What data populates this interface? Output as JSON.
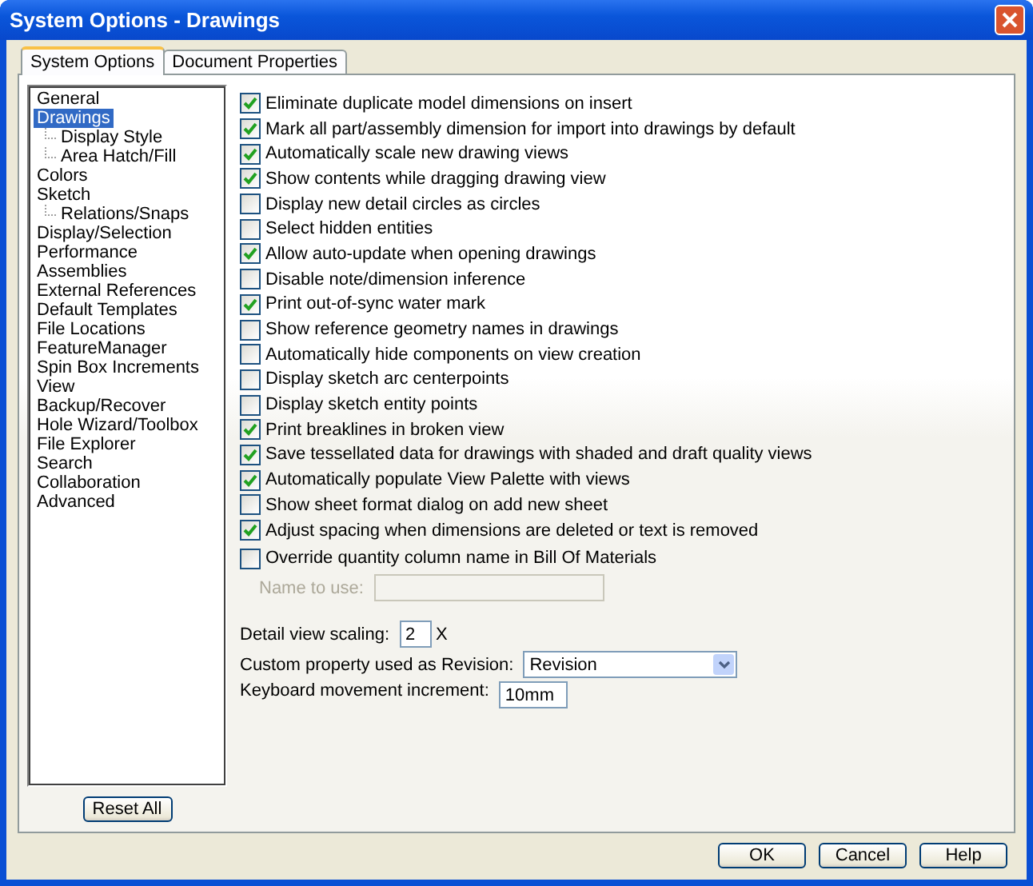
{
  "window": {
    "title": "System Options - Drawings"
  },
  "tabs": [
    {
      "label": "System Options",
      "selected": true
    },
    {
      "label": "Document Properties",
      "selected": false
    }
  ],
  "tree": [
    {
      "label": "General",
      "selected": false
    },
    {
      "label": "Drawings",
      "selected": true,
      "children": [
        {
          "label": "Display Style",
          "selected": false
        },
        {
          "label": "Area Hatch/Fill",
          "selected": false
        }
      ]
    },
    {
      "label": "Colors",
      "selected": false
    },
    {
      "label": "Sketch",
      "selected": false,
      "children": [
        {
          "label": "Relations/Snaps",
          "selected": false
        }
      ]
    },
    {
      "label": "Display/Selection",
      "selected": false
    },
    {
      "label": "Performance",
      "selected": false
    },
    {
      "label": "Assemblies",
      "selected": false
    },
    {
      "label": "External References",
      "selected": false
    },
    {
      "label": "Default Templates",
      "selected": false
    },
    {
      "label": "File Locations",
      "selected": false
    },
    {
      "label": "FeatureManager",
      "selected": false
    },
    {
      "label": "Spin Box Increments",
      "selected": false
    },
    {
      "label": "View",
      "selected": false
    },
    {
      "label": "Backup/Recover",
      "selected": false
    },
    {
      "label": "Hole Wizard/Toolbox",
      "selected": false
    },
    {
      "label": "File Explorer",
      "selected": false
    },
    {
      "label": "Search",
      "selected": false
    },
    {
      "label": "Collaboration",
      "selected": false
    },
    {
      "label": "Advanced",
      "selected": false
    }
  ],
  "reset_button": "Reset All",
  "options": [
    {
      "label": "Eliminate duplicate model dimensions on insert",
      "checked": true
    },
    {
      "label": "Mark all part/assembly dimension for import into drawings by default",
      "checked": true
    },
    {
      "label": "Automatically scale new drawing views",
      "checked": true
    },
    {
      "label": "Show contents while dragging drawing view",
      "checked": true
    },
    {
      "label": "Display new detail circles as circles",
      "checked": false
    },
    {
      "label": "Select hidden entities",
      "checked": false
    },
    {
      "label": "Allow auto-update when opening drawings",
      "checked": true
    },
    {
      "label": "Disable note/dimension inference",
      "checked": false
    },
    {
      "label": "Print out-of-sync water mark",
      "checked": true
    },
    {
      "label": "Show reference geometry names in drawings",
      "checked": false
    },
    {
      "label": "Automatically hide components on view creation",
      "checked": false
    },
    {
      "label": "Display sketch arc centerpoints",
      "checked": false
    },
    {
      "label": "Display sketch entity points",
      "checked": false
    },
    {
      "label": "Print breaklines in broken view",
      "checked": true
    },
    {
      "label": "Save tessellated data for drawings with shaded and draft quality views",
      "checked": true
    },
    {
      "label": "Automatically populate View Palette with views",
      "checked": true
    },
    {
      "label": "Show sheet format dialog on add new sheet",
      "checked": false
    },
    {
      "label": "Adjust spacing when dimensions are deleted or text is removed",
      "checked": true
    },
    {
      "label": "Override quantity column name in Bill Of Materials",
      "checked": false
    }
  ],
  "name_to_use": {
    "label": "Name to use:",
    "disabled": true
  },
  "detail_view_scaling": {
    "label": "Detail view scaling:",
    "value": "2",
    "unit": "X"
  },
  "revision_property": {
    "label": "Custom property used as Revision:",
    "value": "Revision"
  },
  "keyboard_increment": {
    "label": "Keyboard movement increment:",
    "value": "10mm"
  },
  "buttons": [
    "OK",
    "Cancel",
    "Help"
  ]
}
